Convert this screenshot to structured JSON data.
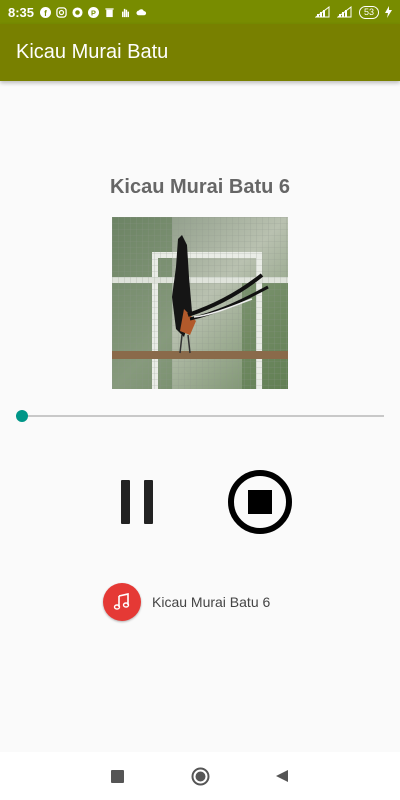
{
  "status_bar": {
    "time": "8:35",
    "battery": "53",
    "icons": [
      "facebook-icon",
      "instagram-icon",
      "app-icon",
      "p-icon",
      "trash-icon",
      "hand-icon",
      "cloud-icon"
    ]
  },
  "app_bar": {
    "title": "Kicau Murai Batu"
  },
  "player": {
    "track_title": "Kicau Murai Batu 6",
    "progress": 0,
    "now_playing_label": "Kicau Murai Batu 6"
  },
  "colors": {
    "status_bar": "#788c00",
    "app_bar": "#788000",
    "accent": "#009688",
    "music_icon": "#e53935"
  }
}
